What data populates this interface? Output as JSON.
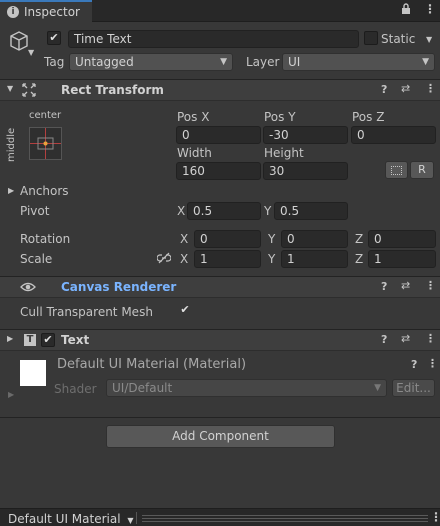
{
  "tab": {
    "title": "Inspector"
  },
  "gameobject": {
    "active": true,
    "name": "Time Text",
    "static_label": "Static",
    "static": false,
    "tag_label": "Tag",
    "tag_value": "Untagged",
    "layer_label": "Layer",
    "layer_value": "UI"
  },
  "rect_transform": {
    "title": "Rect Transform",
    "anchor_preset": {
      "horizontal": "center",
      "vertical": "middle"
    },
    "pos_x_label": "Pos X",
    "pos_x": "0",
    "pos_y_label": "Pos Y",
    "pos_y": "-30",
    "pos_z_label": "Pos Z",
    "pos_z": "0",
    "width_label": "Width",
    "width": "160",
    "height_label": "Height",
    "height": "30",
    "raw_edit_button": "R",
    "anchors_label": "Anchors",
    "pivot_label": "Pivot",
    "pivot_x": "0.5",
    "pivot_y": "0.5",
    "rotation_label": "Rotation",
    "rot_x": "0",
    "rot_y": "0",
    "rot_z": "0",
    "scale_label": "Scale",
    "scale_x": "1",
    "scale_y": "1",
    "scale_z": "1",
    "x_label": "X",
    "y_label": "Y",
    "z_label": "Z"
  },
  "canvas_renderer": {
    "title": "Canvas Renderer",
    "cull_label": "Cull Transparent Mesh",
    "cull": true
  },
  "text_component": {
    "title": "Text",
    "enabled": true
  },
  "material": {
    "title": "Default UI Material (Material)",
    "shader_label": "Shader",
    "shader_value": "UI/Default",
    "edit_button": "Edit..."
  },
  "add_component_button": "Add Component",
  "bottom": {
    "material_dropdown": "Default UI Material"
  },
  "colors": {
    "accent": "#3a79bb",
    "link_title": "#7ab4ff",
    "background": "#383838"
  }
}
